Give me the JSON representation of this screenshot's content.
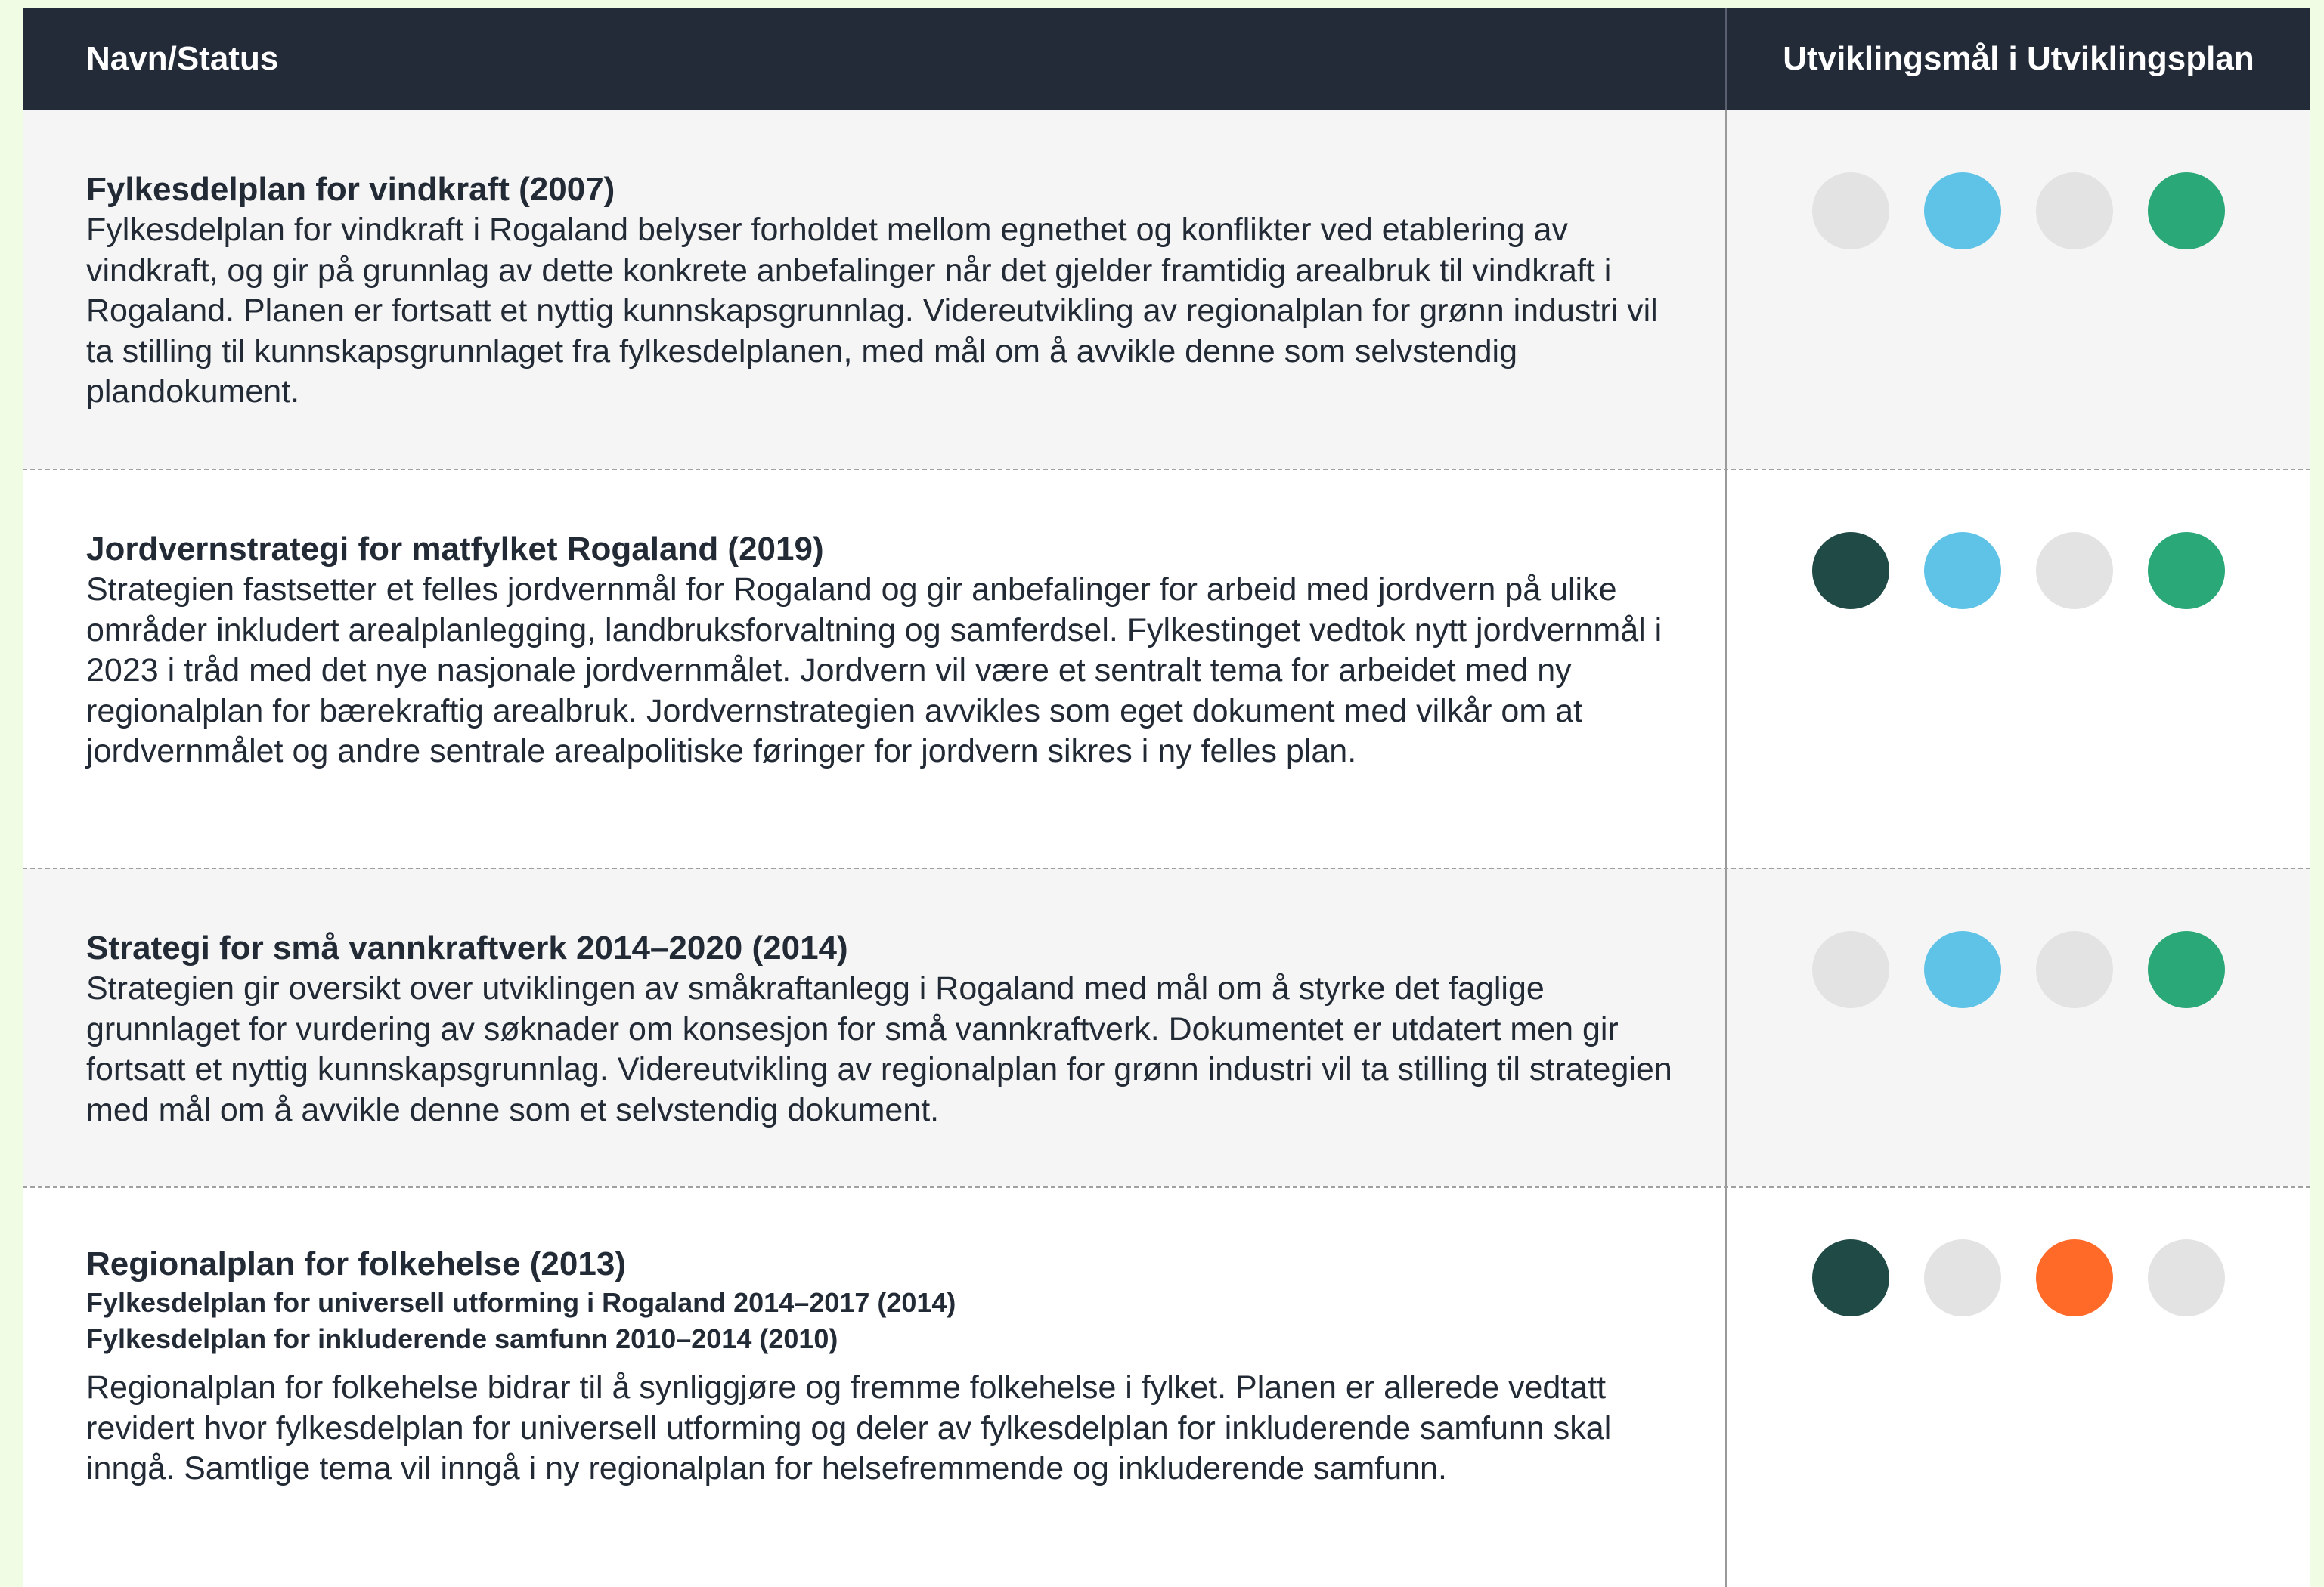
{
  "header": {
    "col_left": "Navn/Status",
    "col_right": "Utviklingsmål i Utviklingsplan"
  },
  "colors": {
    "inactive": "#e3e3e3",
    "dark_green": "#1f4a45",
    "light_blue": "#5ec3e6",
    "green": "#2aa878",
    "orange": "#ff6a28"
  },
  "rows": [
    {
      "title": "Fylkesdelplan for vindkraft (2007)",
      "description": "Fylkesdelplan for vindkraft i Rogaland belyser forholdet mellom egnethet og konflikter ved etablering av vindkraft, og gir på grunnlag av dette konkrete anbefalinger når det gjelder framtidig arealbruk til vindkraft i Rogaland. Planen er fortsatt et nyttig kunnskapsgrunnlag. Videreutvikling av regionalplan for grønn industri vil ta stilling til kunnskapsgrunnlaget fra fylkesdelplanen, med mål om å avvikle denne som selvstendig plandokument.",
      "goals": [
        "#e3e3e3",
        "#5ec3e6",
        "#e3e3e3",
        "#2aa878"
      ]
    },
    {
      "title": "Jordvernstrategi for matfylket Rogaland (2019)",
      "description": "Strategien fastsetter et felles jordvernmål for Rogaland og gir anbefalinger for arbeid med jordvern på ulike områder inkludert arealplanlegging, landbruksforvaltning og samferdsel. Fylkestinget vedtok nytt jordvernmål i 2023 i tråd med det nye nasjonale jordvernmålet. Jordvern vil være et sentralt tema for arbeidet med ny regionalplan for bærekraftig arealbruk. Jordvernstrategien avvikles som eget dokument med vilkår om at jordvernmålet og andre sentrale arealpolitiske føringer for jordvern sikres i ny felles plan.",
      "goals": [
        "#1f4a45",
        "#5ec3e6",
        "#e3e3e3",
        "#2aa878"
      ]
    },
    {
      "title": "Strategi for små vannkraftverk 2014–2020 (2014)",
      "description": "Strategien gir oversikt over utviklingen av småkraftanlegg i Rogaland med mål om å styrke det faglige grunnlaget for vurdering av søknader om konsesjon for små vannkraftverk. Dokumentet er utdatert men gir fortsatt et nyttig kunnskapsgrunnlag. Videreutvikling av regionalplan for grønn industri vil ta stilling til strategien med mål om å avvikle denne som et selvstendig dokument.",
      "goals": [
        "#e3e3e3",
        "#5ec3e6",
        "#e3e3e3",
        "#2aa878"
      ]
    },
    {
      "title": "Regionalplan for folkehelse (2013)",
      "subtitles": [
        "Fylkesdelplan for universell utforming i Rogaland 2014–2017 (2014)",
        "Fylkesdelplan for inkluderende samfunn 2010–2014 (2010)"
      ],
      "description": "Regionalplan for folkehelse bidrar til å synliggjøre og fremme folkehelse i fylket. Planen er allerede vedtatt revidert hvor fylkesdelplan for universell utforming og deler av fylkesdelplan for inkluderende samfunn skal inngå. Samtlige tema vil inngå i ny regionalplan for helsefremmende og inkluderende samfunn.",
      "goals": [
        "#1f4a45",
        "#e3e3e3",
        "#ff6a28",
        "#e3e3e3"
      ]
    }
  ]
}
